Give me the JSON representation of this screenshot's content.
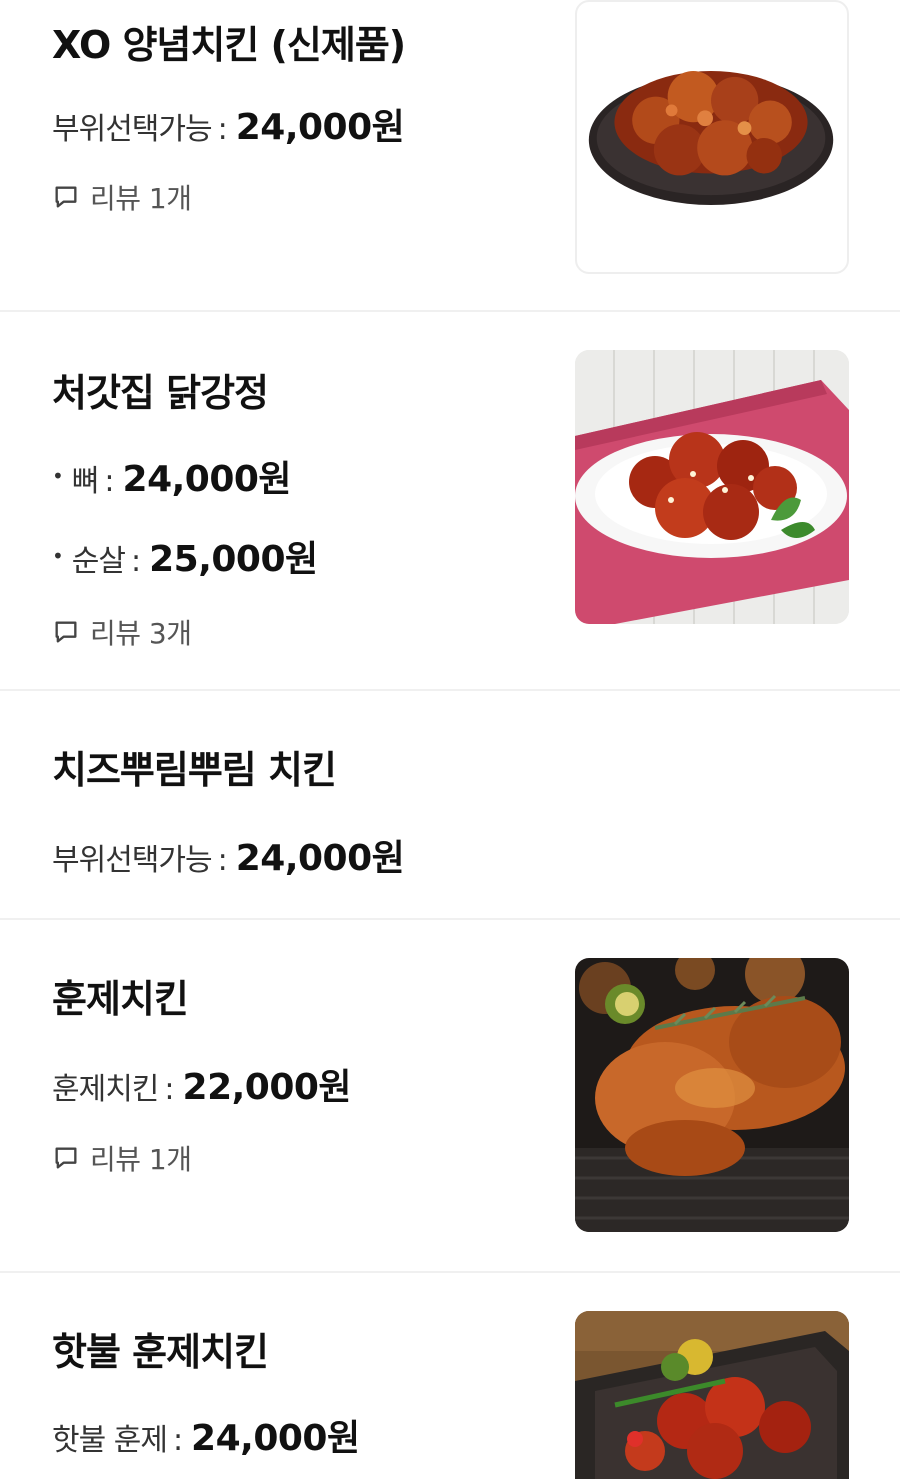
{
  "items": [
    {
      "name": "XO 양념치킨 (신제품)",
      "prices": [
        {
          "label": "부위선택가능",
          "value": "24,000원"
        }
      ],
      "review": "리뷰 1개",
      "image": "sweet-spicy-chicken-on-black-plate"
    },
    {
      "name": "처갓집 닭강정",
      "prices": [
        {
          "label": "뼈",
          "value": "24,000원"
        },
        {
          "label": "순살",
          "value": "25,000원"
        }
      ],
      "review": "리뷰 3개",
      "image": "glazed-chicken-on-white-plate"
    },
    {
      "name": "치즈뿌림뿌림 치킨",
      "prices": [
        {
          "label": "부위선택가능",
          "value": "24,000원"
        }
      ]
    },
    {
      "name": "훈제치킨",
      "prices": [
        {
          "label": "훈제치킨",
          "value": "22,000원"
        }
      ],
      "review": "리뷰 1개",
      "image": "smoked-chicken-on-grill"
    },
    {
      "name": "핫불 훈제치킨",
      "prices": [
        {
          "label": "핫불 훈제",
          "value": "24,000원"
        }
      ],
      "image": "spicy-smoked-chicken-on-skillet"
    }
  ],
  "icons": {
    "review": "speech-bubble-icon"
  },
  "colors": {
    "divider": "#f0f0f0",
    "name": "#111111",
    "review": "#555555"
  }
}
